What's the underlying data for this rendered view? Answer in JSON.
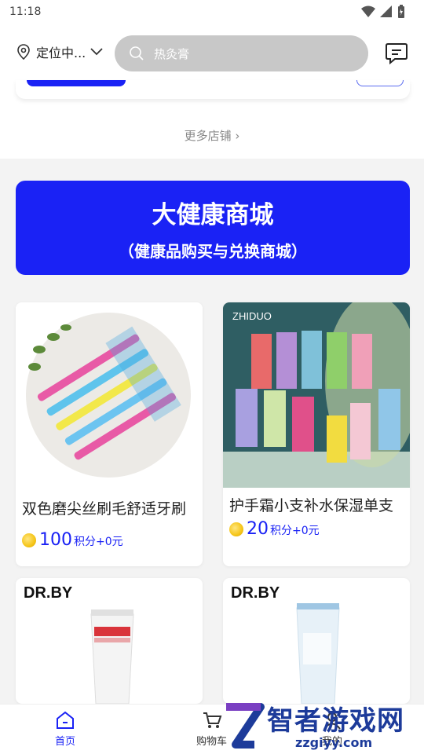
{
  "status_bar": {
    "time": "11:18"
  },
  "header": {
    "location_label": "定位中...",
    "search_placeholder": "热灸膏"
  },
  "stores": {
    "more_label": "更多店铺 ›"
  },
  "banner": {
    "title": "大健康商城",
    "subtitle": "（健康品购买与兑换商城）"
  },
  "products": [
    {
      "name": "双色磨尖丝刷毛舒适牙刷",
      "points": "100",
      "suffix": "积分+0元"
    },
    {
      "name": "护手霜小支补水保湿单支",
      "points": "20",
      "suffix": "积分+0元",
      "brand": "ZHIDUO"
    },
    {
      "name": "",
      "brand": "DR.BY"
    },
    {
      "name": "",
      "brand": "DR.BY"
    }
  ],
  "bottom_nav": {
    "home": "首页",
    "cart": "购物车",
    "mine": "我的"
  },
  "watermark": {
    "text": "智者游戏网",
    "url": "zzgiyy.com"
  },
  "colors": {
    "accent": "#1a22f5",
    "search_bg": "#c8c8c8"
  }
}
